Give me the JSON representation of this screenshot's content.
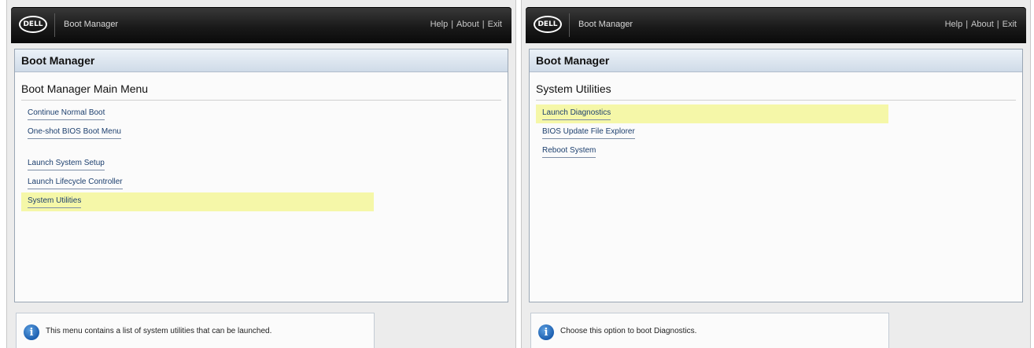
{
  "left": {
    "logo_text": "DELL",
    "title": "Boot Manager",
    "links": [
      "Help",
      "About",
      "Exit"
    ],
    "header": "Boot Manager",
    "section_title": "Boot Manager Main Menu",
    "items": [
      {
        "label": "Continue Normal Boot",
        "highlighted": false
      },
      {
        "label": "One-shot BIOS Boot Menu",
        "highlighted": false
      },
      {
        "label": "Launch System Setup",
        "highlighted": false
      },
      {
        "label": "Launch Lifecycle Controller",
        "highlighted": false
      },
      {
        "label": "System Utilities",
        "highlighted": true
      }
    ],
    "info_text": "This menu contains a list of system utilities that can be launched."
  },
  "right": {
    "logo_text": "DELL",
    "title": "Boot Manager",
    "links": [
      "Help",
      "About",
      "Exit"
    ],
    "header": "Boot Manager",
    "section_title": "System Utilities",
    "items": [
      {
        "label": "Launch Diagnostics",
        "highlighted": true
      },
      {
        "label": "BIOS Update File Explorer",
        "highlighted": false
      },
      {
        "label": "Reboot System",
        "highlighted": false
      }
    ],
    "info_text": "Choose this option to boot Diagnostics."
  },
  "colors": {
    "highlight": "#f5f7a8",
    "link": "#1c3f6e",
    "header_gradient_top": "#ecf2f8",
    "header_gradient_bottom": "#cfdbe8",
    "topbar": "#1a1a1a"
  },
  "icons": {
    "info": "info-icon",
    "logo": "dell-logo-icon"
  }
}
